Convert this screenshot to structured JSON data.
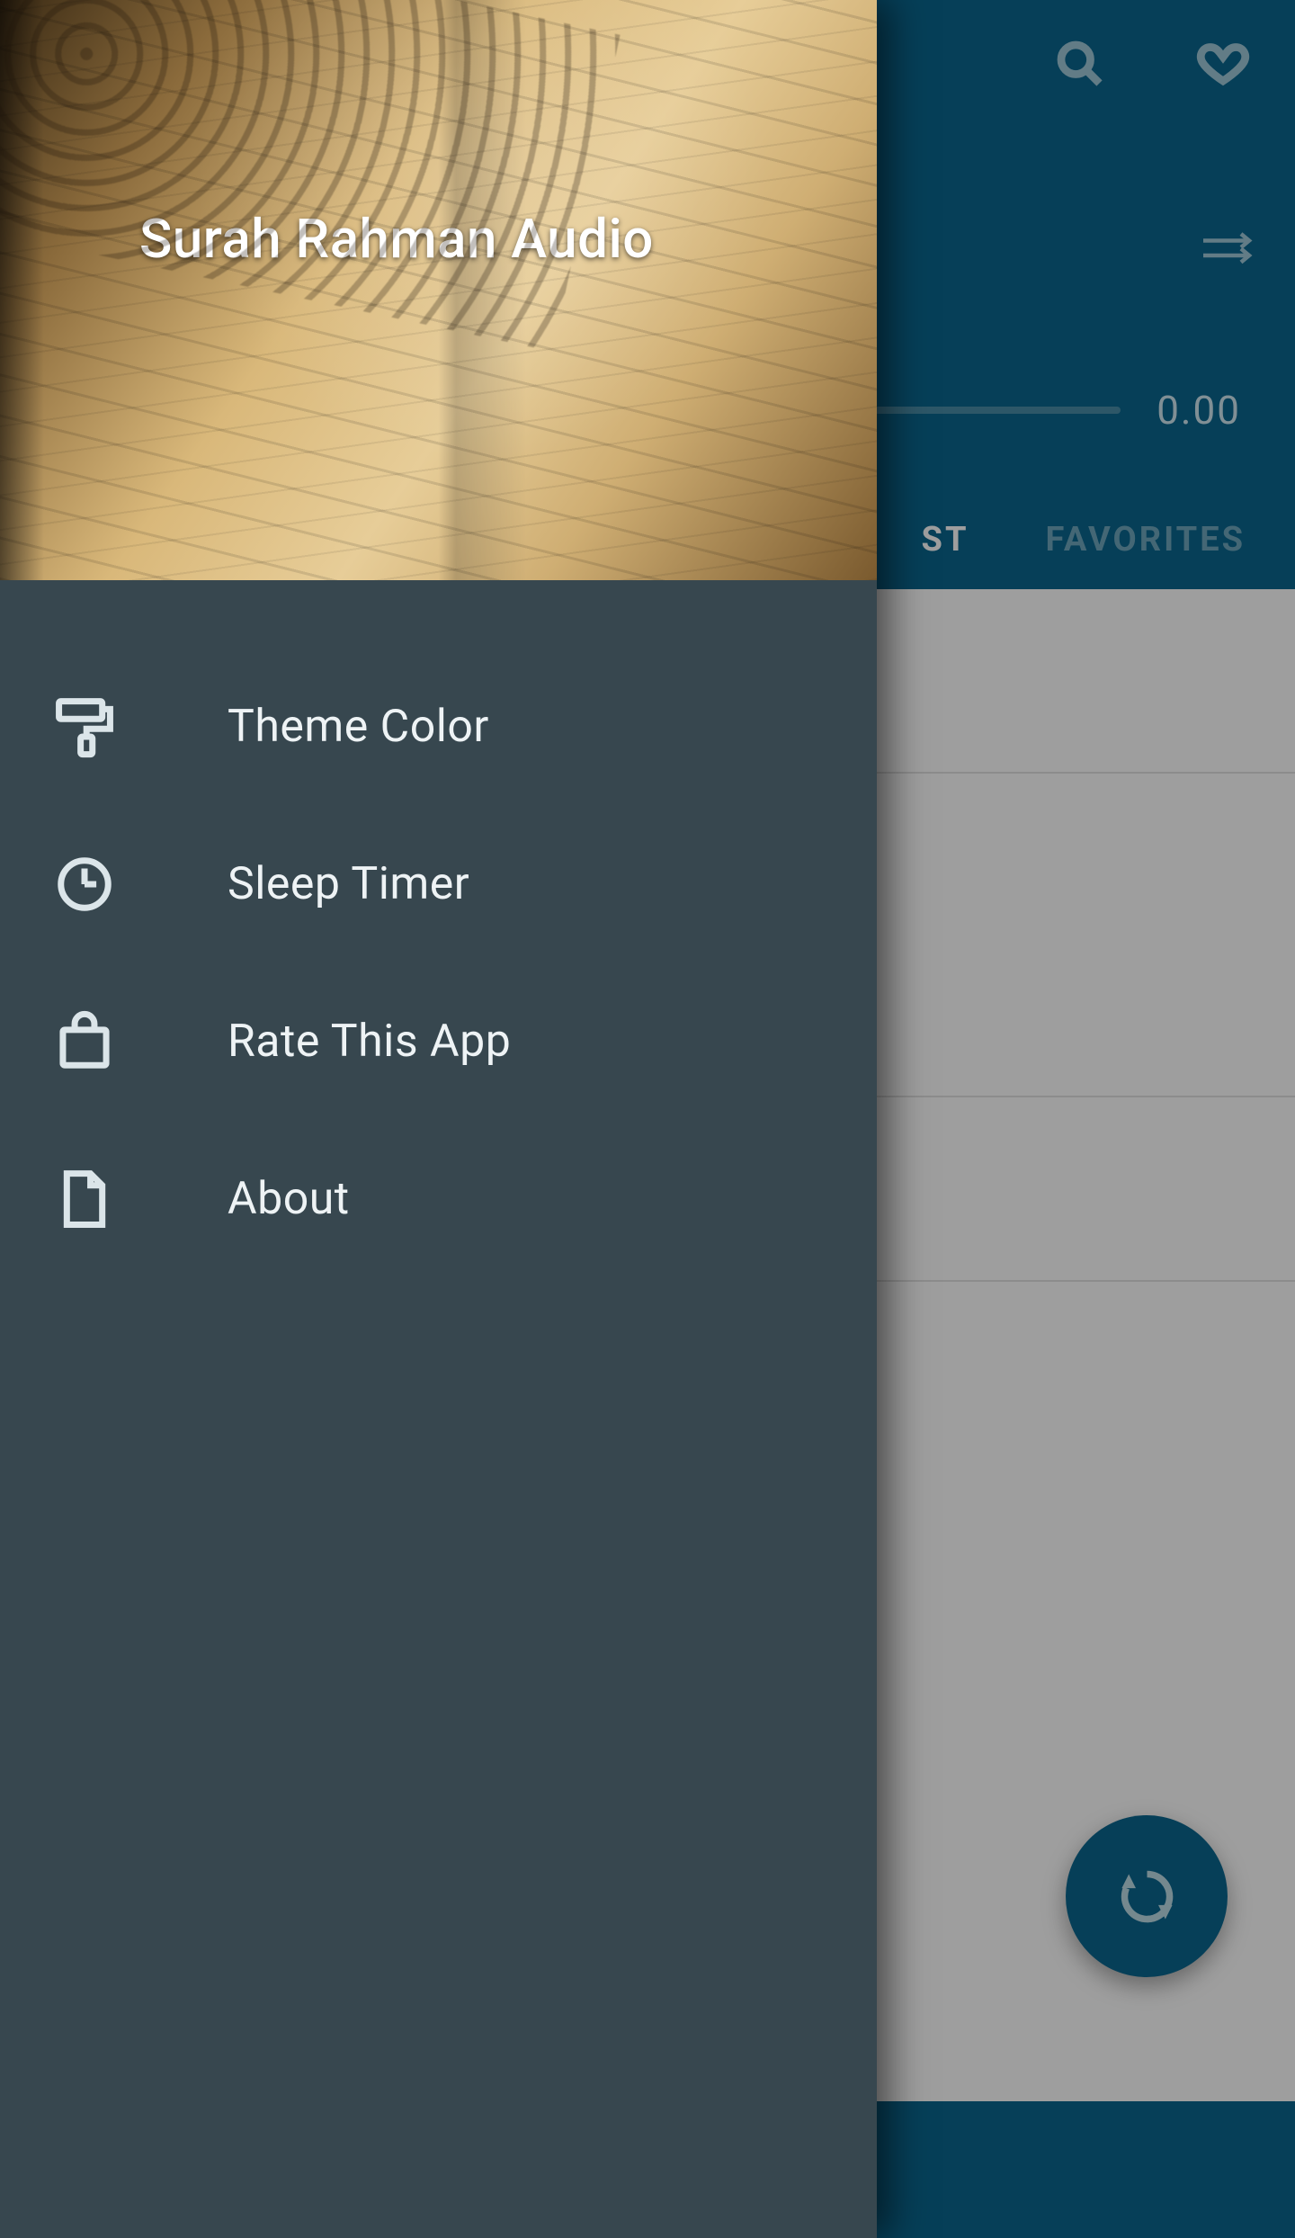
{
  "app": {
    "drawer_title": "Surah Rahman Audio",
    "header": {
      "current_time": "0.00"
    },
    "tabs": {
      "playlist": "ST",
      "favorites": "FAVORITES"
    },
    "menu": {
      "theme_color": "Theme Color",
      "sleep_timer": "Sleep Timer",
      "rate_app": "Rate This App",
      "about": "About"
    },
    "icons": {
      "search": "search-icon",
      "favorite": "heart-icon",
      "repeat_arrows": "repeat-arrows-icon",
      "fab_refresh": "refresh-icon",
      "theme": "paint-roller-icon",
      "clock": "clock-icon",
      "bag": "shopping-bag-icon",
      "file": "file-icon"
    },
    "colors": {
      "brand": "#0b678e",
      "drawer_bg": "#37474f",
      "icon_tint": "#9fc8d9"
    }
  }
}
